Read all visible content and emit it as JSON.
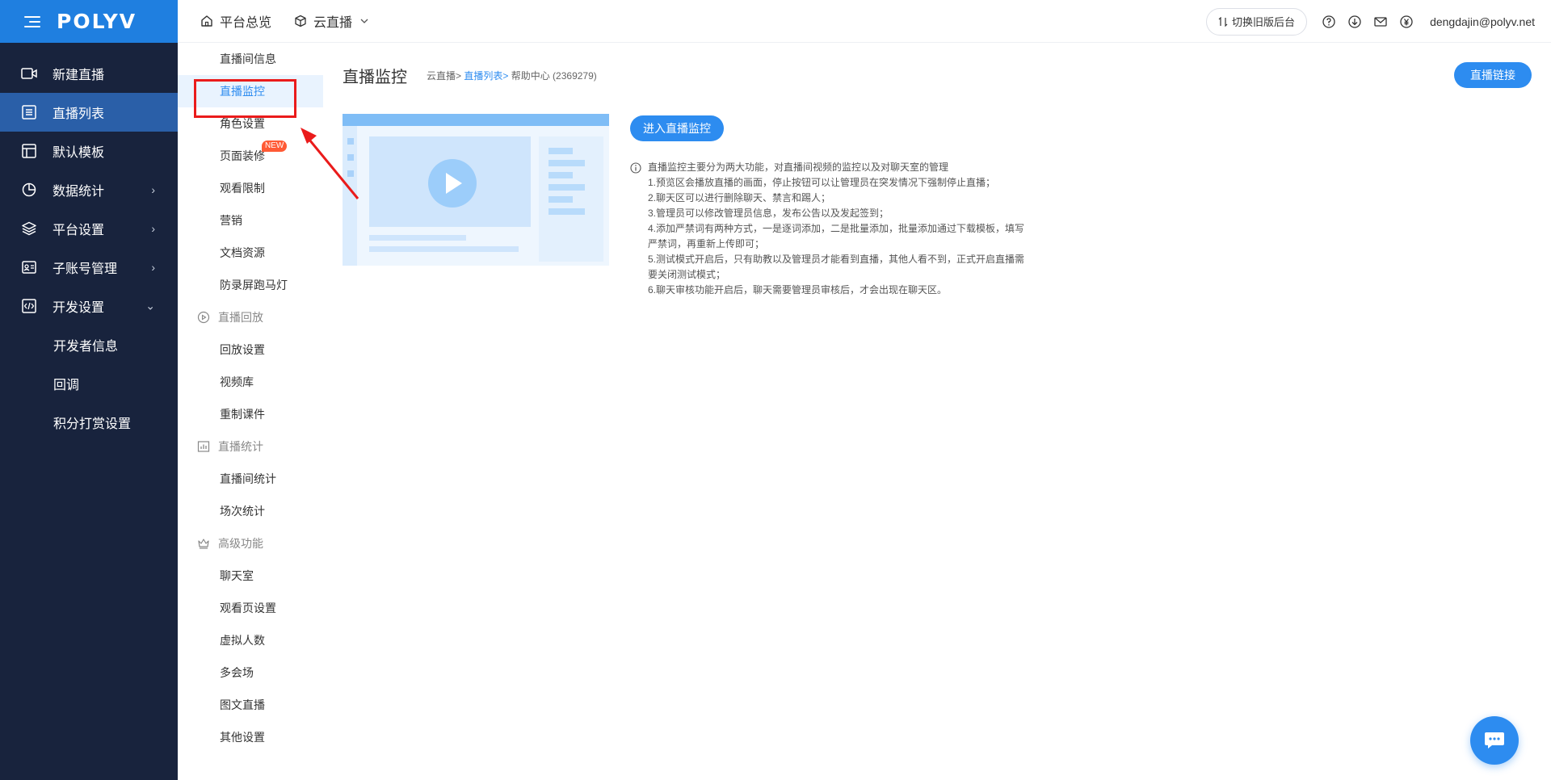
{
  "brand": {
    "logo_text": "POLYV",
    "accent": "#1f7fe0",
    "sidebar_bg": "#18233d",
    "active_bg": "#2a5fa8"
  },
  "sidebar": {
    "items": [
      {
        "label": "新建直播",
        "icon": "video-camera-icon",
        "has_chevron": false
      },
      {
        "label": "直播列表",
        "icon": "list-icon",
        "has_chevron": false,
        "active": true
      },
      {
        "label": "默认模板",
        "icon": "template-icon",
        "has_chevron": false
      },
      {
        "label": "数据统计",
        "icon": "pie-chart-icon",
        "has_chevron": true,
        "chevron": "›"
      },
      {
        "label": "平台设置",
        "icon": "layers-icon",
        "has_chevron": true,
        "chevron": "›"
      },
      {
        "label": "子账号管理",
        "icon": "id-card-icon",
        "has_chevron": true,
        "chevron": "›"
      },
      {
        "label": "开发设置",
        "icon": "code-icon",
        "has_chevron": true,
        "chevron": "⌄",
        "expanded": true
      }
    ],
    "sub_items": [
      "开发者信息",
      "回调",
      "积分打赏设置"
    ]
  },
  "topbar": {
    "home_label": "平台总览",
    "product_label": "云直播",
    "switch_label": "切换旧版后台",
    "user_email": "dengdajin@polyv.net"
  },
  "submenu": {
    "live_items": [
      "直播间信息",
      "直播监控",
      "角色设置",
      "页面装修",
      "观看限制",
      "营销",
      "文档资源",
      "防录屏跑马灯"
    ],
    "new_badge": "NEW",
    "playback_group": "直播回放",
    "playback_items": [
      "回放设置",
      "视频库",
      "重制课件"
    ],
    "stats_group": "直播统计",
    "stats_items": [
      "直播间统计",
      "场次统计"
    ],
    "advanced_group": "高级功能",
    "advanced_items": [
      "聊天室",
      "观看页设置",
      "虚拟人数",
      "多会场",
      "图文直播",
      "其他设置"
    ]
  },
  "content": {
    "title": "直播监控",
    "breadcrumb": {
      "root": "云直播>",
      "link": "直播列表>",
      "current": "帮助中心 (2369279)"
    },
    "live_link_button": "直播链接",
    "enter_button": "进入直播监控",
    "desc_title": "直播监控主要分为两大功能，对直播间视频的监控以及对聊天室的管理",
    "desc_lines": [
      "1.预览区会播放直播的画面，停止按钮可以让管理员在突发情况下强制停止直播；",
      "2.聊天区可以进行删除聊天、禁言和踢人；",
      "3.管理员可以修改管理员信息，发布公告以及发起签到；",
      "4.添加严禁词有两种方式，一是逐词添加，二是批量添加，批量添加通过下载模板，填写严禁词，再重新上传即可；",
      "5.测试模式开启后，只有助教以及管理员才能看到直播，其他人看不到，正式开启直播需要关闭测试模式；",
      "6.聊天审核功能开启后，聊天需要管理员审核后，才会出现在聊天区。"
    ]
  }
}
